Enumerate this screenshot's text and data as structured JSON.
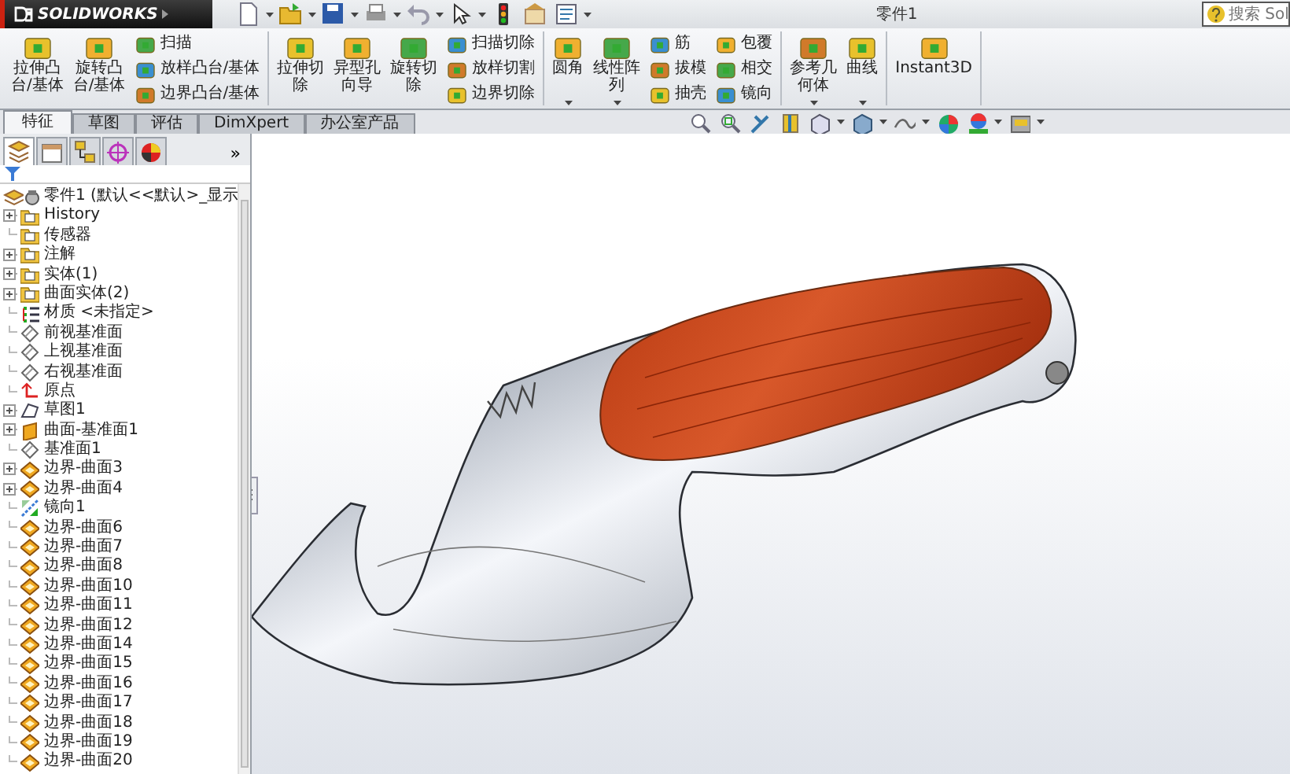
{
  "app": {
    "logo_text": "SOLIDWORKS",
    "title": "零件1",
    "search_placeholder": "搜索 Sol"
  },
  "ribbon": {
    "groups": [
      {
        "items": [
          {
            "kind": "large",
            "lines": [
              "拉伸凸",
              "台/基体"
            ],
            "has_menu": false
          },
          {
            "kind": "large",
            "lines": [
              "旋转凸",
              "台/基体"
            ],
            "has_menu": false
          },
          {
            "kind": "stack",
            "entries": [
              "扫描",
              "放样凸台/基体",
              "边界凸台/基体"
            ]
          }
        ]
      },
      {
        "items": [
          {
            "kind": "large",
            "lines": [
              "拉伸切",
              "除"
            ],
            "has_menu": false
          },
          {
            "kind": "large",
            "lines": [
              "异型孔",
              "向导"
            ],
            "has_menu": false
          },
          {
            "kind": "large",
            "lines": [
              "旋转切",
              "除"
            ],
            "has_menu": false
          },
          {
            "kind": "stack",
            "entries": [
              "扫描切除",
              "放样切割",
              "边界切除"
            ]
          }
        ]
      },
      {
        "items": [
          {
            "kind": "large",
            "lines": [
              "圆角"
            ],
            "has_menu": true
          },
          {
            "kind": "large",
            "lines": [
              "线性阵",
              "列"
            ],
            "has_menu": true
          },
          {
            "kind": "stack",
            "entries": [
              "筋",
              "拔模",
              "抽壳"
            ]
          },
          {
            "kind": "stack",
            "entries": [
              "包覆",
              "相交",
              "镜向"
            ]
          }
        ]
      },
      {
        "items": [
          {
            "kind": "large",
            "lines": [
              "参考几",
              "何体"
            ],
            "has_menu": true
          },
          {
            "kind": "large",
            "lines": [
              "曲线"
            ],
            "has_menu": true
          }
        ]
      },
      {
        "items": [
          {
            "kind": "large",
            "lines": [
              "Instant3D"
            ],
            "has_menu": false
          }
        ]
      }
    ]
  },
  "tabs": [
    {
      "label": "特征",
      "selected": true
    },
    {
      "label": "草图",
      "selected": false
    },
    {
      "label": "评估",
      "selected": false
    },
    {
      "label": "DimXpert",
      "selected": false
    },
    {
      "label": "办公室产品",
      "selected": false
    }
  ],
  "panel_tabs": [
    {
      "selected": true
    },
    {
      "selected": false
    },
    {
      "selected": false
    },
    {
      "selected": false
    },
    {
      "selected": false
    }
  ],
  "panel_more": "»",
  "feature_tree": {
    "label": "零件1  (默认<<默认>_显示",
    "children": [
      {
        "label": "History",
        "kind": "folder",
        "expandable": true
      },
      {
        "label": "传感器",
        "kind": "folder",
        "expandable": false
      },
      {
        "label": "注解",
        "kind": "folder",
        "expandable": true
      },
      {
        "label": "实体(1)",
        "kind": "folder",
        "expandable": true
      },
      {
        "label": "曲面实体(2)",
        "kind": "folder",
        "expandable": true
      },
      {
        "label": "材质 <未指定>",
        "kind": "material",
        "expandable": false
      },
      {
        "label": "前视基准面",
        "kind": "plane",
        "expandable": false
      },
      {
        "label": "上视基准面",
        "kind": "plane",
        "expandable": false
      },
      {
        "label": "右视基准面",
        "kind": "plane",
        "expandable": false
      },
      {
        "label": "原点",
        "kind": "origin",
        "expandable": false
      },
      {
        "label": "草图1",
        "kind": "sketch",
        "expandable": true
      },
      {
        "label": "曲面-基准面1",
        "kind": "surface",
        "expandable": true
      },
      {
        "label": "基准面1",
        "kind": "plane",
        "expandable": false
      },
      {
        "label": "边界-曲面3",
        "kind": "boundary",
        "expandable": true
      },
      {
        "label": "边界-曲面4",
        "kind": "boundary",
        "expandable": true
      },
      {
        "label": "镜向1",
        "kind": "mirror",
        "expandable": false
      },
      {
        "label": "边界-曲面6",
        "kind": "boundary",
        "expandable": false
      },
      {
        "label": "边界-曲面7",
        "kind": "boundary",
        "expandable": false
      },
      {
        "label": "边界-曲面8",
        "kind": "boundary",
        "expandable": false
      },
      {
        "label": "边界-曲面10",
        "kind": "boundary",
        "expandable": false
      },
      {
        "label": "边界-曲面11",
        "kind": "boundary",
        "expandable": false
      },
      {
        "label": "边界-曲面12",
        "kind": "boundary",
        "expandable": false
      },
      {
        "label": "边界-曲面14",
        "kind": "boundary",
        "expandable": false
      },
      {
        "label": "边界-曲面15",
        "kind": "boundary",
        "expandable": false
      },
      {
        "label": "边界-曲面16",
        "kind": "boundary",
        "expandable": false
      },
      {
        "label": "边界-曲面17",
        "kind": "boundary",
        "expandable": false
      },
      {
        "label": "边界-曲面18",
        "kind": "boundary",
        "expandable": false
      },
      {
        "label": "边界-曲面19",
        "kind": "boundary",
        "expandable": false
      },
      {
        "label": "边界-曲面20",
        "kind": "boundary",
        "expandable": false
      }
    ]
  }
}
